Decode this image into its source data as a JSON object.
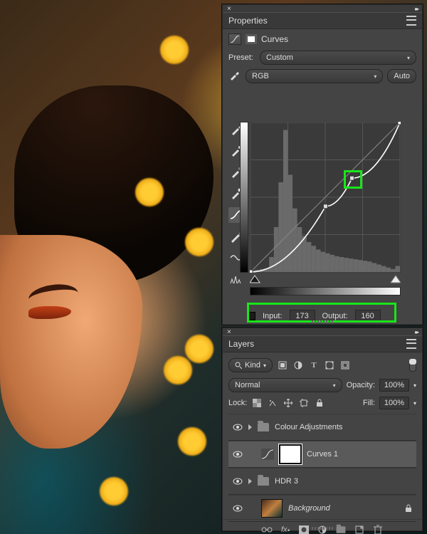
{
  "properties": {
    "title": "Properties",
    "adjustment_name": "Curves",
    "preset_label": "Preset:",
    "preset_value": "Custom",
    "channel_value": "RGB",
    "auto_label": "Auto",
    "input_label": "Input:",
    "input_value": "173",
    "output_label": "Output:",
    "output_value": "160"
  },
  "layers": {
    "title": "Layers",
    "filter_kind": "Kind",
    "blend_mode": "Normal",
    "opacity_label": "Opacity:",
    "opacity_value": "100%",
    "lock_label": "Lock:",
    "fill_label": "Fill:",
    "fill_value": "100%",
    "items": [
      {
        "name": "Colour Adjustments"
      },
      {
        "name": "Curves 1"
      },
      {
        "name": "HDR 3"
      },
      {
        "name": "Background"
      }
    ]
  },
  "chart_data": {
    "type": "line",
    "title": "",
    "xlabel": "Input",
    "ylabel": "Output",
    "xlim": [
      0,
      255
    ],
    "ylim": [
      0,
      255
    ],
    "series": [
      {
        "name": "curve",
        "values": [
          [
            0,
            0
          ],
          [
            128,
            112
          ],
          [
            173,
            160
          ],
          [
            255,
            255
          ]
        ]
      },
      {
        "name": "baseline",
        "values": [
          [
            0,
            0
          ],
          [
            255,
            255
          ]
        ]
      }
    ],
    "histogram": {
      "bins": 32,
      "values": [
        2,
        3,
        4,
        5,
        20,
        60,
        120,
        190,
        130,
        85,
        60,
        48,
        40,
        35,
        30,
        27,
        25,
        23,
        21,
        20,
        19,
        18,
        17,
        16,
        15,
        14,
        12,
        10,
        8,
        6,
        4,
        8
      ]
    },
    "highlight_point": {
      "input": 173,
      "output": 160
    }
  }
}
